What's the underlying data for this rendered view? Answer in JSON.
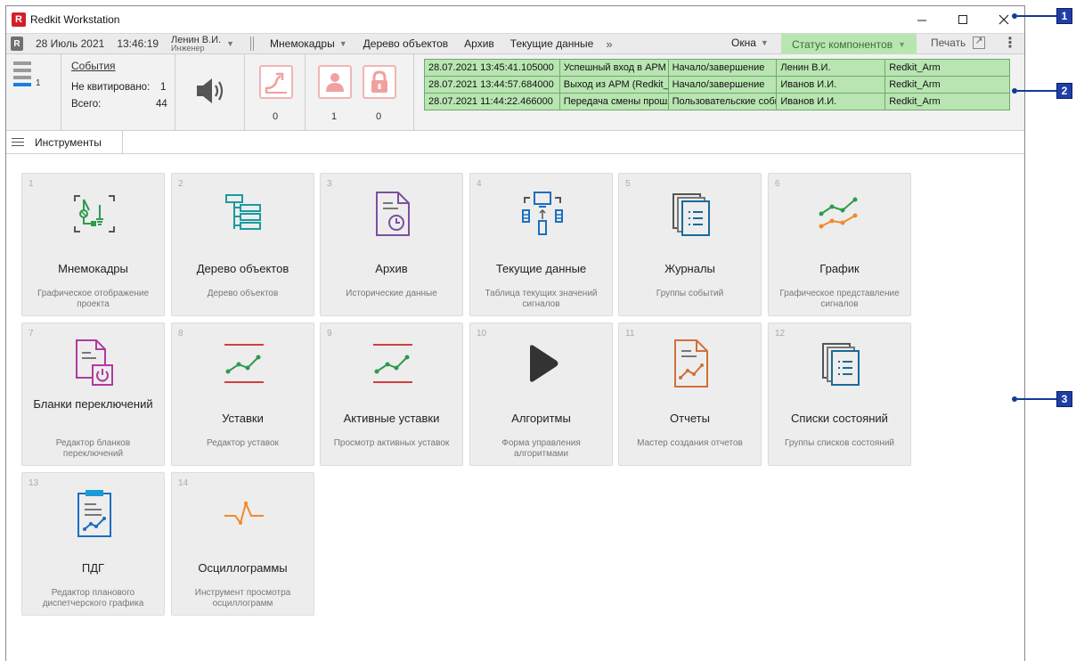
{
  "window": {
    "title": "Redkit Workstation"
  },
  "menubar": {
    "date": "28 Июль 2021",
    "time": "13:46:19",
    "user_name": "Ленин В.И.",
    "user_role": "Инженер",
    "items": [
      "Мнемокадры",
      "Дерево объектов",
      "Архив",
      "Текущие данные"
    ],
    "more": "»",
    "windows": "Окна",
    "status": "Статус компонентов",
    "print": "Печать"
  },
  "events": {
    "title": "События",
    "unack_label": "Не квитировано:",
    "unack_value": "1",
    "total_label": "Всего:",
    "total_value": "44",
    "bar_count": "1",
    "counter_1": "0",
    "counter_2": "1",
    "counter_3": "0",
    "rows": [
      [
        "28.07.2021 13:45:41.105000",
        "Успешный вход в АРМ",
        "Начало/завершение",
        "Ленин В.И.",
        "Redkit_Arm"
      ],
      [
        "28.07.2021 13:44:57.684000",
        "Выход из АРМ (Redkit_Arm)",
        "Начало/завершение",
        "Иванов  И.И.",
        "Redkit_Arm"
      ],
      [
        "28.07.2021 11:44:22.466000",
        "Передача смены прошла успешно",
        "Пользовательские события",
        "Иванов  И.И.",
        "Redkit_Arm"
      ]
    ]
  },
  "tools": {
    "label": "Инструменты"
  },
  "tiles": [
    {
      "num": "1",
      "name": "Мнемокадры",
      "desc": "Графическое отображение проекта",
      "icon": "mnemo-icon"
    },
    {
      "num": "2",
      "name": "Дерево объектов",
      "desc": "Дерево объектов",
      "icon": "object-tree-icon"
    },
    {
      "num": "3",
      "name": "Архив",
      "desc": "Исторические данные",
      "icon": "archive-icon"
    },
    {
      "num": "4",
      "name": "Текущие данные",
      "desc": "Таблица текущих значений сигналов",
      "icon": "current-data-icon"
    },
    {
      "num": "5",
      "name": "Журналы",
      "desc": "Группы событий",
      "icon": "journals-icon"
    },
    {
      "num": "6",
      "name": "График",
      "desc": "Графическое представление сигналов",
      "icon": "chart-icon"
    },
    {
      "num": "7",
      "name": "Бланки переключений",
      "desc": "Редактор бланков переключений",
      "icon": "switching-forms-icon"
    },
    {
      "num": "8",
      "name": "Уставки",
      "desc": "Редактор уставок",
      "icon": "setpoints-icon"
    },
    {
      "num": "9",
      "name": "Активные уставки",
      "desc": "Просмотр активных уставок",
      "icon": "active-setpoints-icon"
    },
    {
      "num": "10",
      "name": "Алгоритмы",
      "desc": "Форма управления алгоритмами",
      "icon": "play-icon"
    },
    {
      "num": "11",
      "name": "Отчеты",
      "desc": "Мастер создания отчетов",
      "icon": "reports-icon"
    },
    {
      "num": "12",
      "name": "Списки состояний",
      "desc": "Группы списков состояний",
      "icon": "state-lists-icon"
    },
    {
      "num": "13",
      "name": "ПДГ",
      "desc": "Редактор планового диспетчерского графика",
      "icon": "pdg-icon"
    },
    {
      "num": "14",
      "name": "Осциллограммы",
      "desc": "Инструмент просмотра осциллограмм",
      "icon": "oscillogram-icon"
    }
  ],
  "callouts": [
    "1",
    "2",
    "3"
  ],
  "colors": {
    "status_green": "#b9e5b2",
    "accent_blue": "#1a7de0",
    "alarm_pink": "#f1b5b5",
    "callout_blue": "#1f3fa6"
  }
}
